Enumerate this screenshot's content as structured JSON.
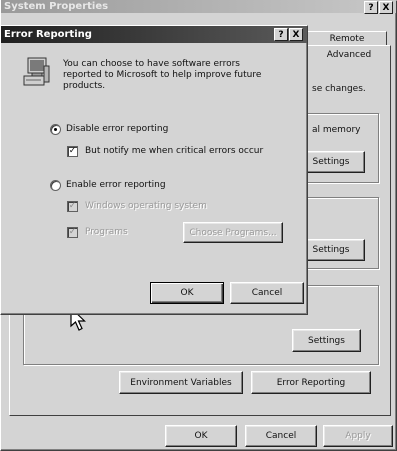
{
  "system_properties": {
    "title": "System Properties",
    "help_btn": "?",
    "close_btn": "X",
    "tabs": [
      "Remote",
      "Advanced"
    ],
    "partial_texts": {
      "changes": "se changes.",
      "memory": "al memory"
    },
    "buttons": {
      "settings": "Settings",
      "env_vars": "Environment Variables",
      "error_reporting": "Error Reporting",
      "ok": "OK",
      "cancel": "Cancel",
      "apply": "Apply"
    }
  },
  "error_reporting": {
    "title": "Error Reporting",
    "help_btn": "?",
    "close_btn": "X",
    "icon": "computer-icon",
    "description": "You can choose to have software errors reported to Microsoft to help improve future products.",
    "disable_option": "Disable error reporting",
    "notify_option": "But notify me when critical errors occur",
    "enable_option": "Enable error reporting",
    "windows_os": "Windows operating system",
    "programs": "Programs",
    "choose_programs": "Choose Programs...",
    "ok": "OK",
    "cancel": "Cancel",
    "selected_radio": "disable",
    "notify_checked": true
  },
  "cursor": {
    "icon": "mouse-pointer-icon"
  }
}
